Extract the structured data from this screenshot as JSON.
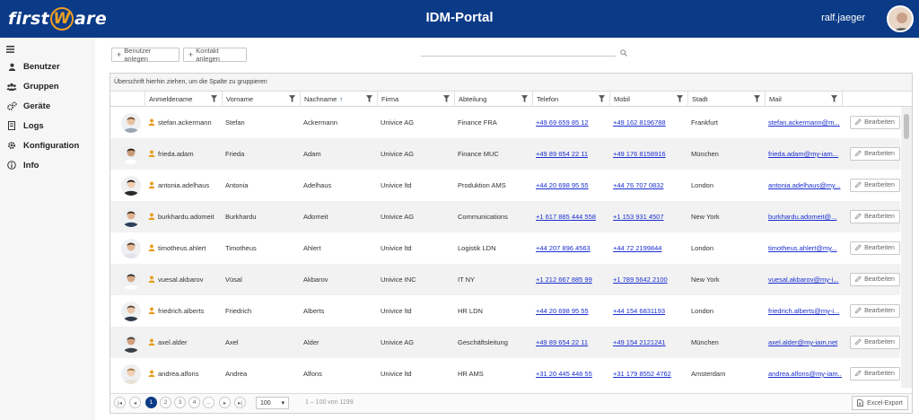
{
  "header": {
    "logo_prefix": "first",
    "logo_w": "W",
    "logo_suffix": "are",
    "title": "IDM-Portal",
    "user": "ralf.jaeger"
  },
  "sidebar": {
    "items": [
      {
        "label": "Benutzer",
        "icon": "user-icon"
      },
      {
        "label": "Gruppen",
        "icon": "users-icon"
      },
      {
        "label": "Geräte",
        "icon": "gears-icon"
      },
      {
        "label": "Logs",
        "icon": "log-book-icon"
      },
      {
        "label": "Konfiguration",
        "icon": "gear-icon"
      },
      {
        "label": "Info",
        "icon": "info-icon"
      }
    ]
  },
  "toolbar": {
    "add_user": "Benutzer anlegen",
    "add_contact": "Kontakt anlegen",
    "search_placeholder": ""
  },
  "grid": {
    "group_hint": "Überschrift hierhin ziehen, um die Spalte zu gruppieren",
    "columns": [
      "Anmeldename",
      "Vorname",
      "Nachname",
      "Firma",
      "Abteilung",
      "Telefon",
      "Mobil",
      "Stadt",
      "Mail"
    ],
    "sort_column": "Nachname",
    "sort_indicator": "↑",
    "edit_label": "Bearbeiten",
    "rows": [
      {
        "login": "stefan.ackermann",
        "first": "Stefan",
        "last": "Ackermann",
        "company": "Univice AG",
        "dept": "Finance FRA",
        "phone": "+49 69 659 85 12",
        "mobile": "+49 162 8196788",
        "city": "Frankfurt",
        "mail": "stefan.ackermann@m..."
      },
      {
        "login": "frieda.adam",
        "first": "Frieda",
        "last": "Adam",
        "company": "Univice AG",
        "dept": "Finance MUC",
        "phone": "+49 89 654 22 11",
        "mobile": "+49 176 8158916",
        "city": "München",
        "mail": "frieda.adam@my-iam..."
      },
      {
        "login": "antonia.adelhaus",
        "first": "Antonia",
        "last": "Adelhaus",
        "company": "Univice ltd",
        "dept": "Produktion AMS",
        "phone": "+44 20 698 95 55",
        "mobile": "+44 76 707 0832",
        "city": "London",
        "mail": "antonia.adelhaus@my..."
      },
      {
        "login": "burkhardu.adomeit",
        "first": "Burkhardu",
        "last": "Adomeit",
        "company": "Univice AG",
        "dept": "Communications",
        "phone": "+1 617 885 444 558",
        "mobile": "+1 153 931 4507",
        "city": "New York",
        "mail": "burkhardu.adomeit@..."
      },
      {
        "login": "timotheus.ahlert",
        "first": "Timotheus",
        "last": "Ahlert",
        "company": "Univice ltd",
        "dept": "Logistik LDN",
        "phone": "+44 207 896 4563",
        "mobile": "+44 72 2199844",
        "city": "London",
        "mail": "timotheus.ahlert@my..."
      },
      {
        "login": "vuesal.akbarov",
        "first": "Vüsal",
        "last": "Akbarov",
        "company": "Univice INC",
        "dept": "IT NY",
        "phone": "+1 212 667 885 99",
        "mobile": "+1 789 5642 2100",
        "city": "New York",
        "mail": "vuesal.akbarov@my-i..."
      },
      {
        "login": "friedrich.alberts",
        "first": "Friedrich",
        "last": "Alberts",
        "company": "Univice ltd",
        "dept": "HR LDN",
        "phone": "+44 20 698 95 55",
        "mobile": "+44 154 6831193",
        "city": "London",
        "mail": "friedrich.alberts@my-i..."
      },
      {
        "login": "axel.alder",
        "first": "Axel",
        "last": "Alder",
        "company": "Univice AG",
        "dept": "Geschäftsleitung",
        "phone": "+49 89 654 22 11",
        "mobile": "+49 154 2121241",
        "city": "München",
        "mail": "axel.alder@my-iam.net"
      },
      {
        "login": "andrea.alfons",
        "first": "Andrea",
        "last": "Alfons",
        "company": "Univice ltd",
        "dept": "HR AMS",
        "phone": "+31 20 445 448 55",
        "mobile": "+31 179 8552 4762",
        "city": "Amsterdam",
        "mail": "andrea.alfons@my-iam..."
      }
    ]
  },
  "pager": {
    "pages": [
      "1",
      "2",
      "3",
      "4",
      "..."
    ],
    "current_page": "1",
    "page_size": "100",
    "info": "1 – 100 von 1199",
    "export": "Excel-Export"
  }
}
